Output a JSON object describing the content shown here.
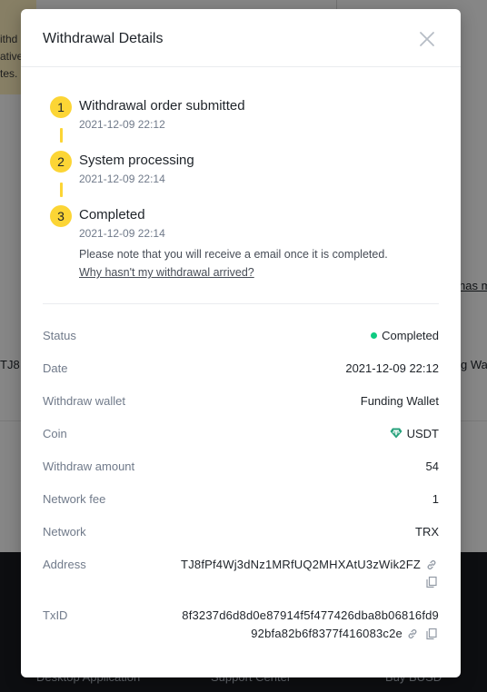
{
  "background": {
    "notice_lines": [
      "ithd",
      "ative",
      "tes."
    ],
    "left_fragment": "TJ8",
    "right_link_fragment": "has m",
    "right_fragment": "g Wa",
    "footer_links": [
      "Desktop Application",
      "Support Center",
      "Buy BUSD"
    ]
  },
  "modal": {
    "title": "Withdrawal Details",
    "steps": [
      {
        "number": "1",
        "title": "Withdrawal order submitted",
        "time": "2021-12-09 22:12"
      },
      {
        "number": "2",
        "title": "System processing",
        "time": "2021-12-09 22:14"
      },
      {
        "number": "3",
        "title": "Completed",
        "time": "2021-12-09 22:14"
      }
    ],
    "note": "Please note that you will receive a email once it is completed.",
    "help_link": "Why hasn't my withdrawal arrived?",
    "details": {
      "status_label": "Status",
      "status_value": "Completed",
      "date_label": "Date",
      "date_value": "2021-12-09 22:12",
      "wallet_label": "Withdraw wallet",
      "wallet_value": "Funding Wallet",
      "coin_label": "Coin",
      "coin_value": "USDT",
      "amount_label": "Withdraw amount",
      "amount_value": "54",
      "fee_label": "Network fee",
      "fee_value": "1",
      "network_label": "Network",
      "network_value": "TRX",
      "address_label": "Address",
      "address_value": "TJ8fPf4Wj3dNz1MRfUQ2MHXAtU3zWik2FZ",
      "txid_label": "TxID",
      "txid_line1": "8f3237d6d8d0e87914f5f477426dba8b06816fd9",
      "txid_line2": "92bfa82b6f8377f416083c2e"
    }
  },
  "colors": {
    "accent": "#fcd535",
    "success": "#0ecb81",
    "coin": "#26a17b",
    "overlay": "rgba(0,0,0,0.45)"
  },
  "icons": {
    "close": "close-icon",
    "coin": "usdt-coin-icon",
    "link": "link-icon",
    "copy": "copy-icon"
  }
}
